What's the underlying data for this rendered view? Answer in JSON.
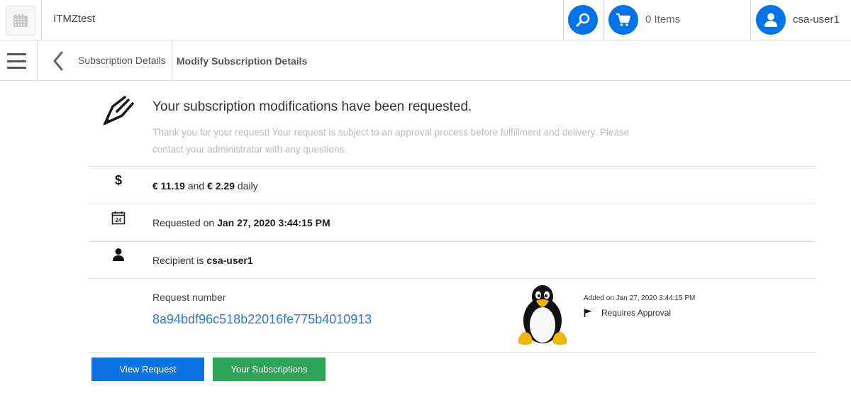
{
  "header": {
    "app_title": "ITMZtest",
    "cart_label": "0 Items",
    "user_name": "csa-user1"
  },
  "breadcrumb": {
    "previous": "Subscription Details",
    "current": "Modify Subscription Details"
  },
  "confirmation": {
    "title": "Your subscription modifications have been requested.",
    "description": "Thank you for your request! Your request is subject to an approval process before fulfillment and delivery. Please contact your administrator with any questions."
  },
  "price": {
    "one_time": "€ 11.19",
    "connector": "and",
    "daily": "€ 2.29",
    "suffix": "daily"
  },
  "requested": {
    "prefix": "Requested on",
    "date": "Jan 27, 2020 3:44:15 PM"
  },
  "recipient": {
    "prefix": "Recipient is",
    "name": "csa-user1"
  },
  "request": {
    "label": "Request number",
    "number": "8a94bdf96c518b22016fe775b4010913",
    "added_on": "Added on Jan 27, 2020 3:44:15 PM",
    "status": "Requires Approval"
  },
  "calendar_day": "24",
  "buttons": {
    "view_request": "View Request",
    "your_subscriptions": "Your Subscriptions"
  },
  "colors": {
    "accent_blue": "#0073e7",
    "link_blue": "#2e7bd6",
    "green": "#2ea35a"
  }
}
